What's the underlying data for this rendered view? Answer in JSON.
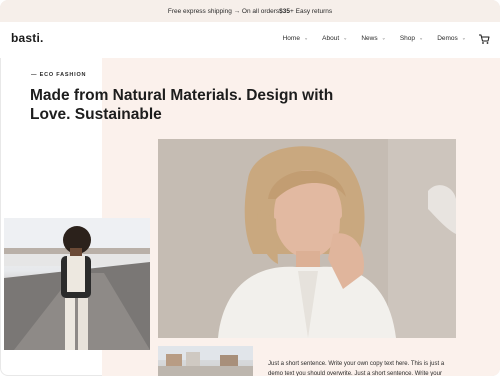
{
  "announcement": {
    "text_before": "Free express shipping → On all orders ",
    "amount": "$35",
    "text_after": " + Easy returns"
  },
  "header": {
    "logo": "basti.",
    "nav": [
      {
        "label": "Home"
      },
      {
        "label": "About"
      },
      {
        "label": "News"
      },
      {
        "label": "Shop"
      },
      {
        "label": "Demos"
      }
    ],
    "cart_icon": "cart-icon"
  },
  "hero": {
    "eyebrow": "— ECO FASHION",
    "headline": "Made from Natural Materials. Design with Love. Sustainable",
    "body": "Just a short sentence. Write your own copy text here. This is just a demo text you should overwrite. Just a short sentence. Write your"
  },
  "colors": {
    "hero_background": "#fbf1ec",
    "announcement_background": "#f6efea"
  }
}
